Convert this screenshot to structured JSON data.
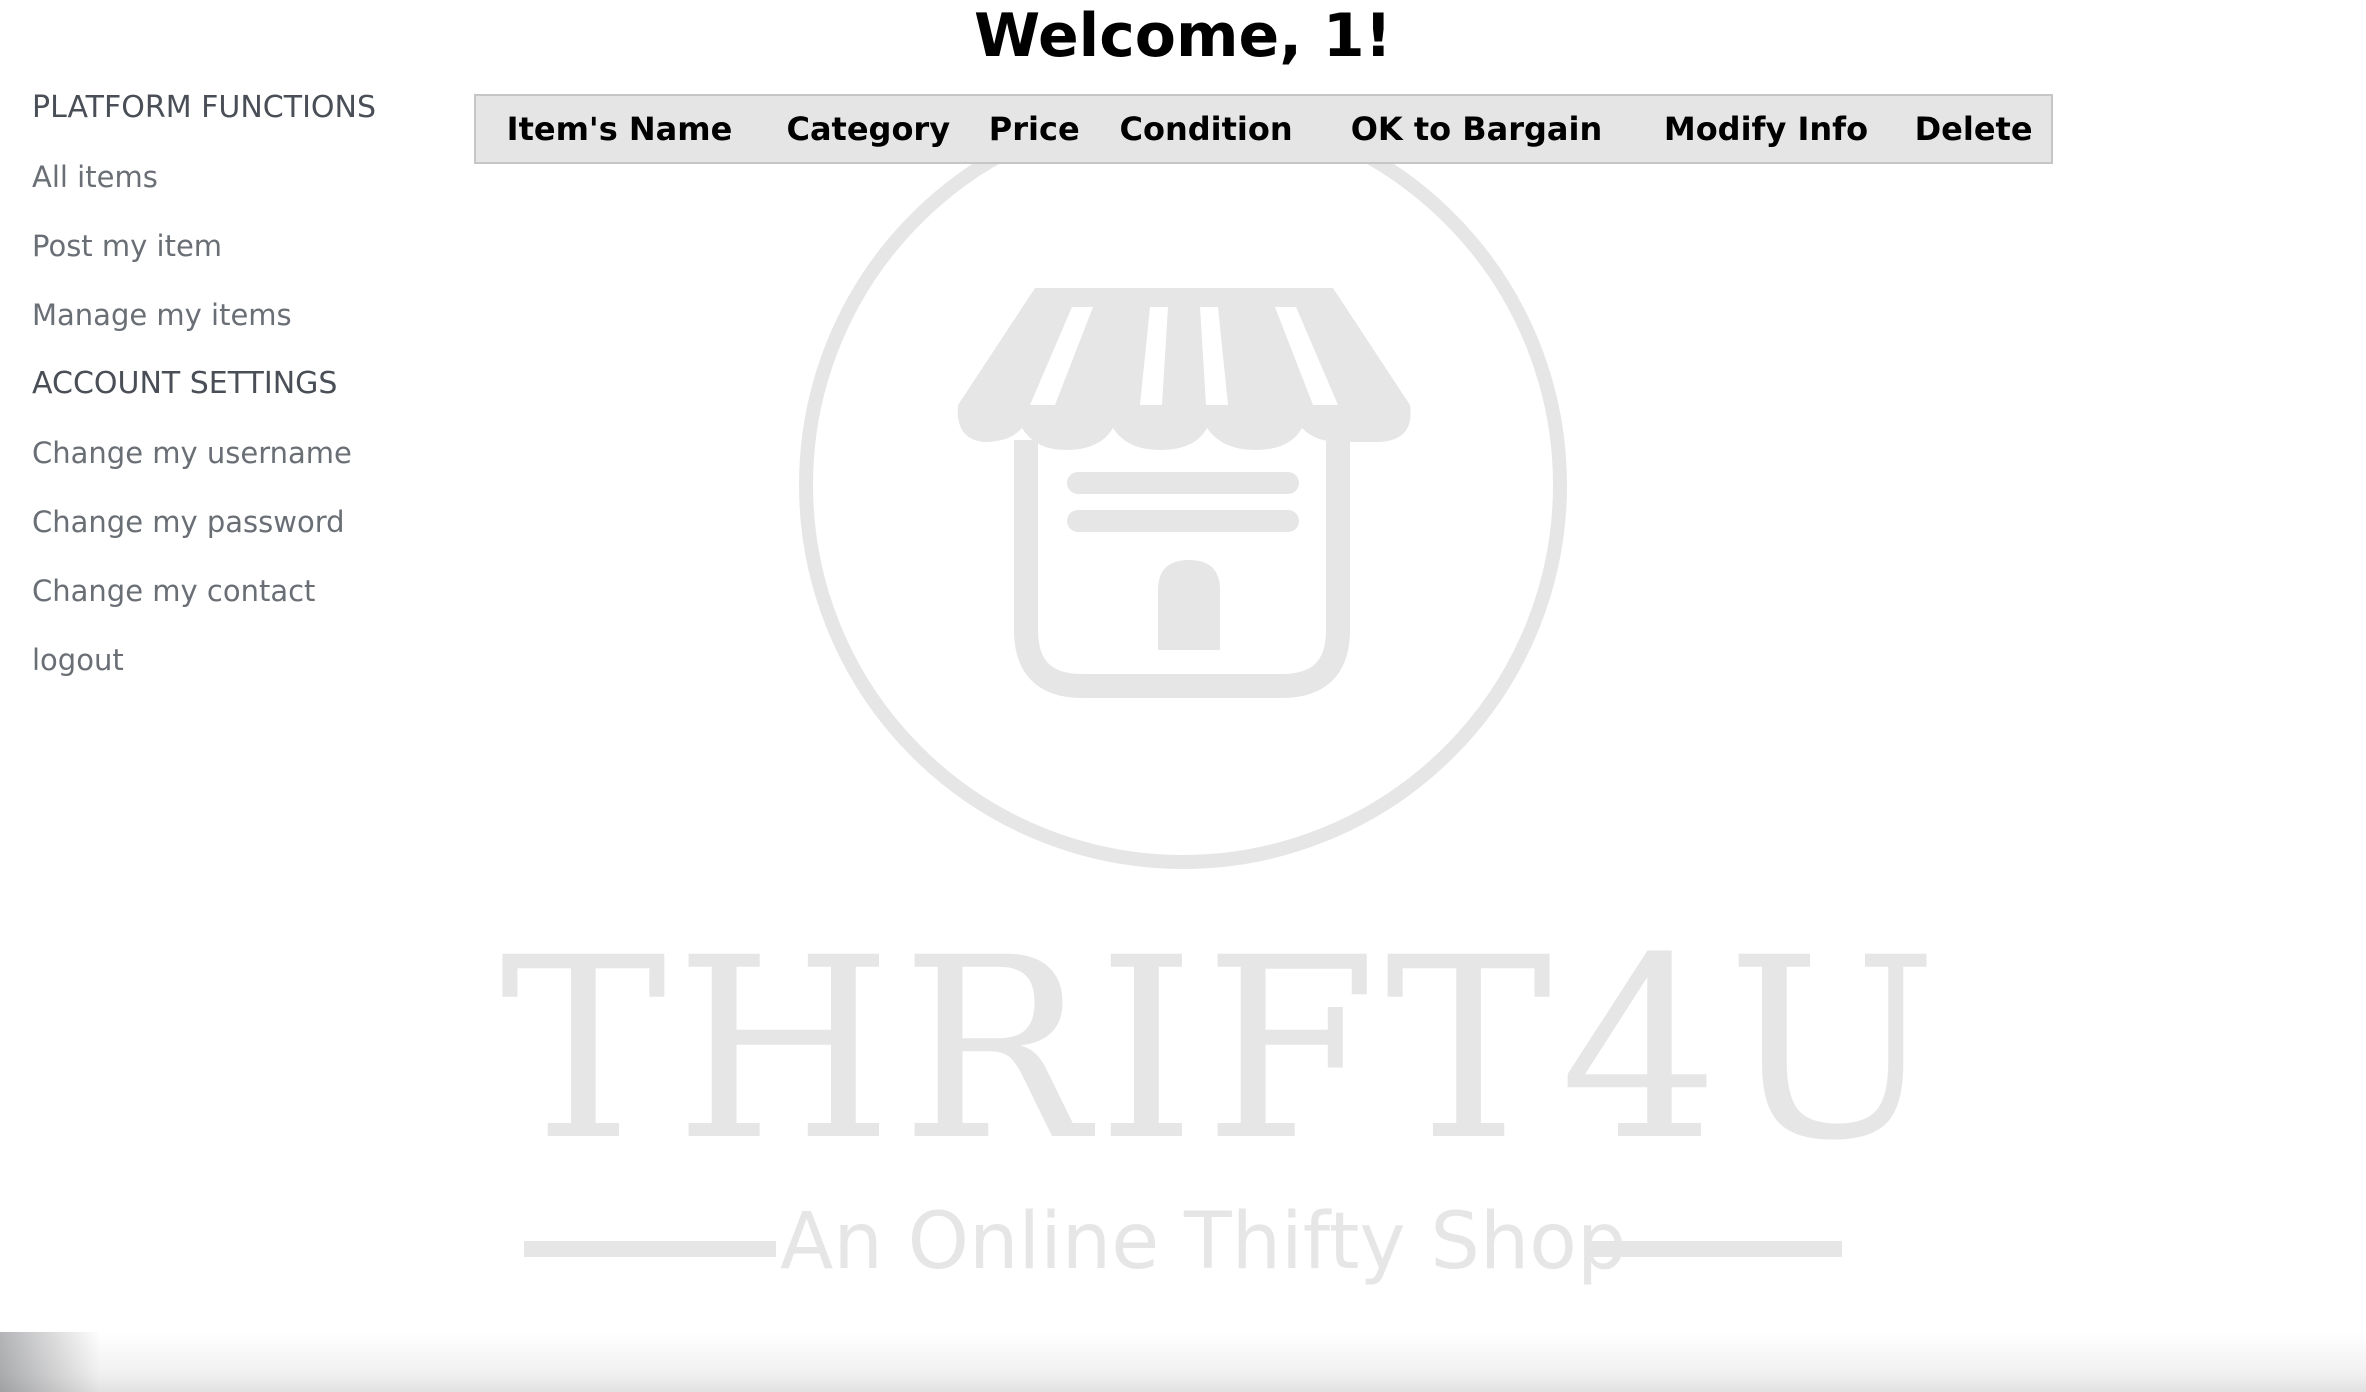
{
  "header": {
    "welcome_text": "Welcome, 1!"
  },
  "sidebar": {
    "platform_section": {
      "title": "PLATFORM FUNCTIONS",
      "items": [
        {
          "label": "All items",
          "icon": ""
        },
        {
          "label": "Post my item",
          "icon": ""
        },
        {
          "label": "Manage my items",
          "icon": ""
        }
      ]
    },
    "account_section": {
      "title": "ACCOUNT SETTINGS",
      "items": [
        {
          "label": "Change my username"
        },
        {
          "label": "Change my password"
        },
        {
          "label": "Change my contact"
        },
        {
          "label": "logout"
        }
      ]
    }
  },
  "table": {
    "columns": [
      "Item's Name",
      "Category",
      "Price",
      "Condition",
      "OK to Bargain",
      "Modify Info",
      "Delete"
    ],
    "rows": []
  },
  "watermark": {
    "brand": "THRIFT4U",
    "tagline": "An Online Thifty Shop",
    "icon": "storefront-icon",
    "color": "#e6e6e6"
  },
  "colors": {
    "section_title": "#4a4f57",
    "nav_link": "#6a6f76",
    "table_header_bg": "#e5e5e5",
    "table_border": "#c6c6c6"
  }
}
